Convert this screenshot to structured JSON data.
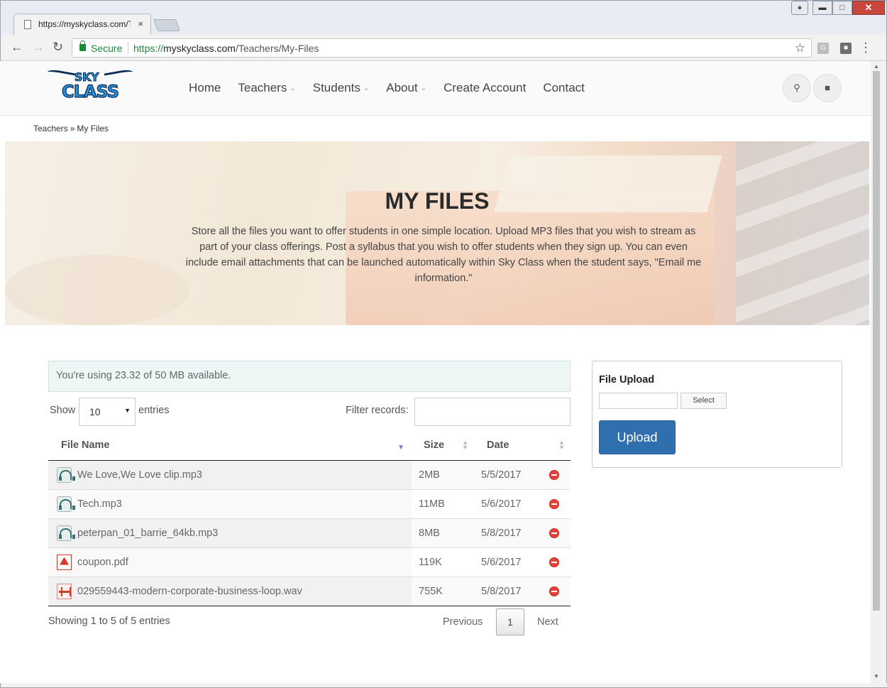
{
  "browser": {
    "tab_title": "https://myskyclass.com/T",
    "tab_close": "×",
    "secure_label": "Secure",
    "url_scheme": "https://",
    "url_host": "myskyclass.com",
    "url_path": "/Teachers/My-Files"
  },
  "logo": {
    "line1": "SKY",
    "line2": "CLASS"
  },
  "nav": {
    "items": [
      {
        "label": "Home",
        "has_dropdown": false
      },
      {
        "label": "Teachers",
        "has_dropdown": true
      },
      {
        "label": "Students",
        "has_dropdown": true
      },
      {
        "label": "About",
        "has_dropdown": true
      },
      {
        "label": "Create Account",
        "has_dropdown": false
      },
      {
        "label": "Contact",
        "has_dropdown": false
      }
    ]
  },
  "breadcrumb": {
    "parent": "Teachers",
    "separator": "»",
    "current": "My Files"
  },
  "hero": {
    "title": "MY FILES",
    "description": "Store all the files you want to offer students in one simple location. Upload MP3 files that you wish to stream as part of your class offerings. Post a syllabus that you wish to offer students when they sign up. You can even include email attachments that can be launched automatically within Sky Class when the student says, \"Email me information.\""
  },
  "usage_text": "You're using 23.32 of 50 MB available.",
  "table_controls": {
    "show_label": "Show",
    "show_value": "10",
    "entries_label": "entries",
    "filter_label": "Filter records:",
    "filter_value": ""
  },
  "table": {
    "columns": [
      "File Name",
      "Size",
      "Date"
    ],
    "rows": [
      {
        "icon": "mp3-file-icon",
        "name": "We Love,We Love clip.mp3",
        "size": "2MB",
        "date": "5/5/2017"
      },
      {
        "icon": "mp3-file-icon",
        "name": "Tech.mp3",
        "size": "11MB",
        "date": "5/6/2017"
      },
      {
        "icon": "mp3-file-icon",
        "name": "peterpan_01_barrie_64kb.mp3",
        "size": "8MB",
        "date": "5/8/2017"
      },
      {
        "icon": "pdf-file-icon",
        "name": "coupon.pdf",
        "size": "119K",
        "date": "5/6/2017"
      },
      {
        "icon": "wav-file-icon",
        "name": "029559443-modern-corporate-business-loop.wav",
        "size": "755K",
        "date": "5/8/2017"
      }
    ]
  },
  "pagination": {
    "info": "Showing 1 to 5 of 5 entries",
    "previous": "Previous",
    "current_page": "1",
    "next": "Next"
  },
  "upload": {
    "title": "File Upload",
    "select_label": "Select",
    "button_label": "Upload"
  },
  "colors": {
    "accent": "#2f6fad",
    "usage_bg": "#eef7f5",
    "delete_red": "#e0443a",
    "secure_green": "#1a8a3a"
  }
}
